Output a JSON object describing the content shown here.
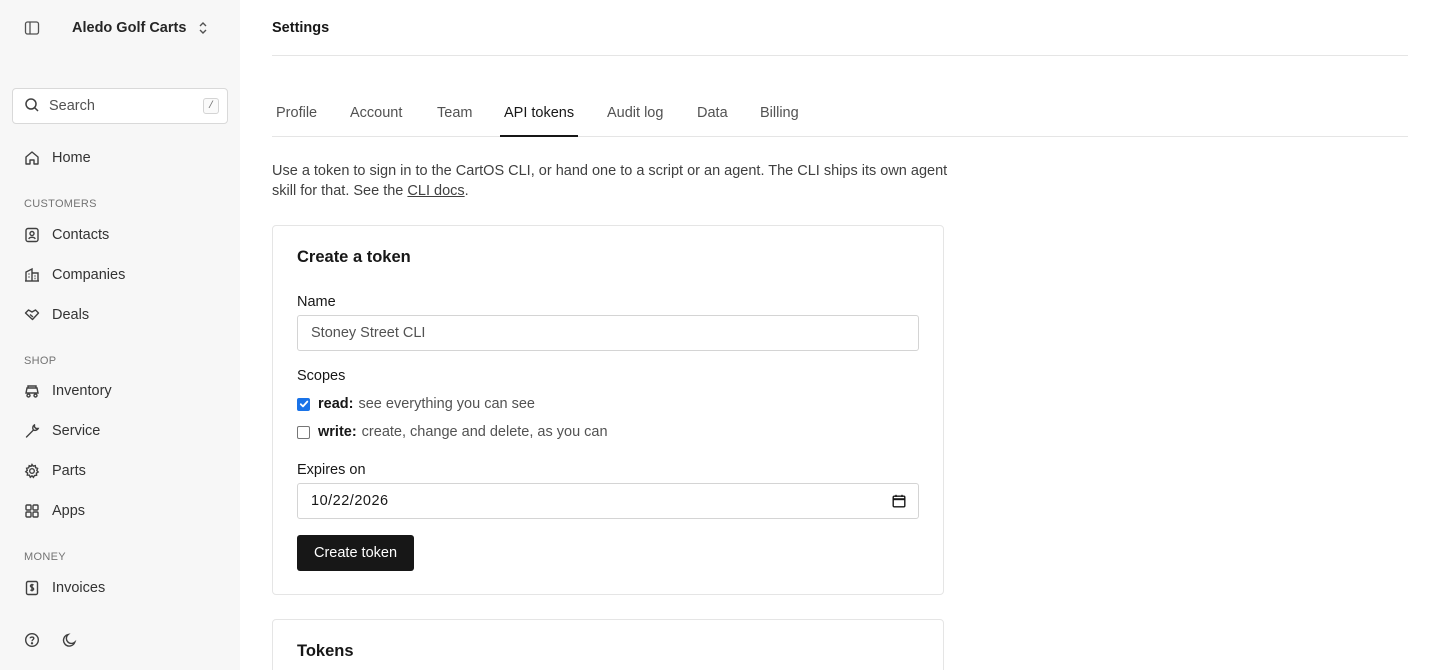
{
  "workspace": {
    "name": "Aledo Golf Carts"
  },
  "search": {
    "label": "Search",
    "shortcut": "/"
  },
  "nav": {
    "home": "Home",
    "sections": {
      "customers": "CUSTOMERS",
      "shop": "SHOP",
      "money": "MONEY"
    },
    "items": {
      "contacts": "Contacts",
      "companies": "Companies",
      "deals": "Deals",
      "inventory": "Inventory",
      "service": "Service",
      "parts": "Parts",
      "apps": "Apps",
      "invoices": "Invoices"
    }
  },
  "page": {
    "title": "Settings"
  },
  "tabs": {
    "profile": "Profile",
    "account": "Account",
    "team": "Team",
    "api_tokens": "API tokens",
    "audit_log": "Audit log",
    "data": "Data",
    "billing": "Billing",
    "active": "API tokens"
  },
  "intro": {
    "text": "Use a token to sign in to the CartOS CLI, or hand one to a script or an agent. The CLI ships its own agent skill for that. See the ",
    "link": "CLI docs",
    "end": "."
  },
  "create_token": {
    "title": "Create a token",
    "name_label": "Name",
    "name_value": "Stoney Street CLI",
    "scopes_label": "Scopes",
    "scope_read_name": "read:",
    "scope_read_desc": "see everything you can see",
    "scope_read_checked": true,
    "scope_write_name": "write:",
    "scope_write_desc": "create, change and delete, as you can",
    "scope_write_checked": false,
    "expires_label": "Expires on",
    "expires_value": "10/22/2026",
    "submit_label": "Create token"
  },
  "tokens": {
    "title": "Tokens"
  },
  "colors": {
    "accent": "#171717",
    "checkbox": "#1a73e8",
    "sidebar_bg": "#f7f7f7"
  }
}
